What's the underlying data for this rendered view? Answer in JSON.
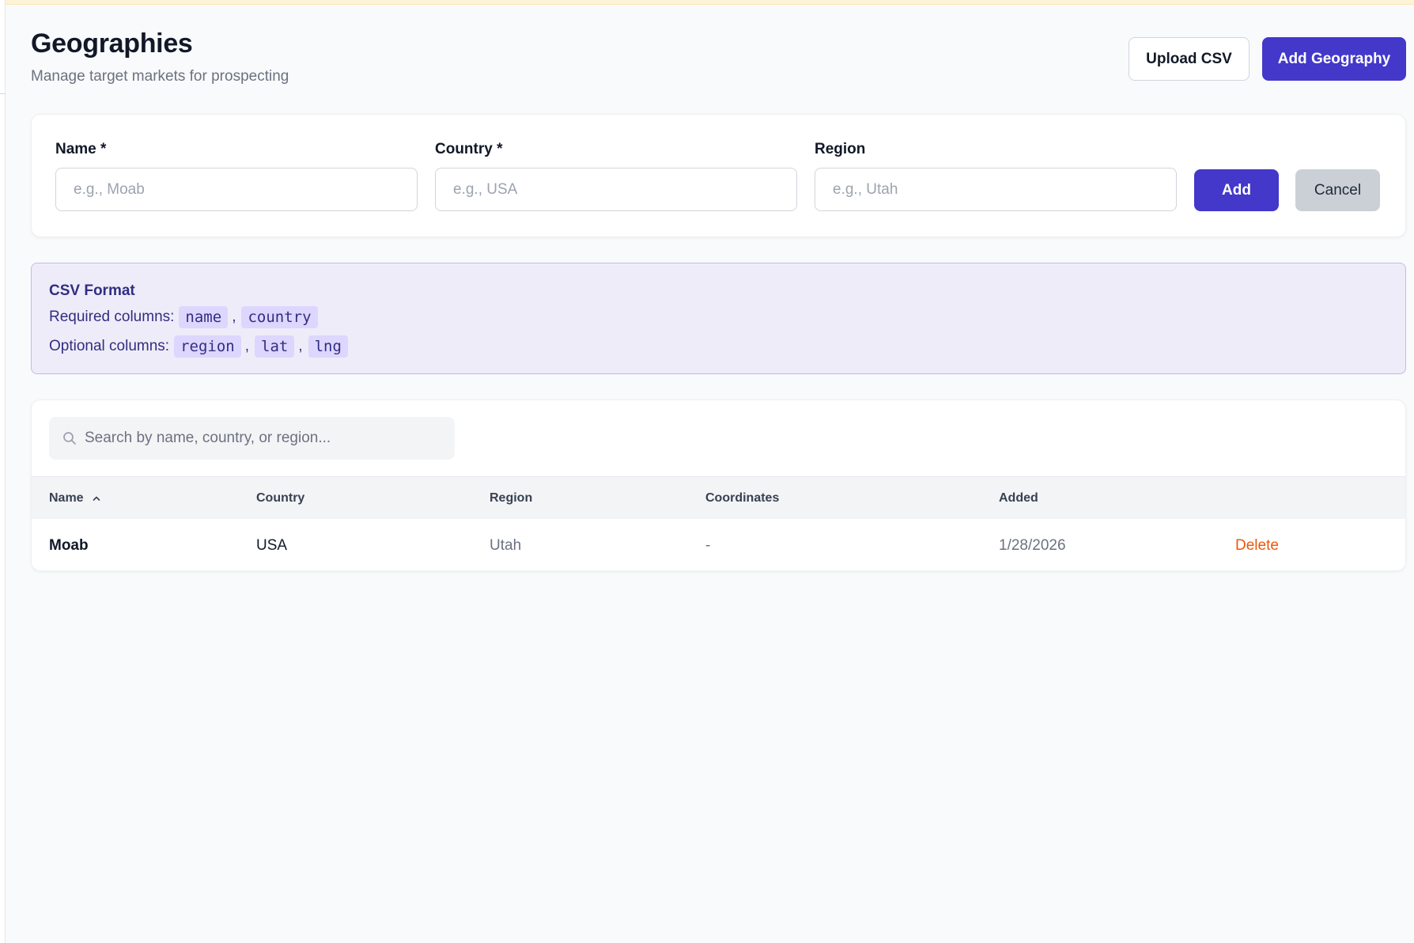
{
  "page": {
    "title": "Geographies",
    "subtitle": "Manage target markets for prospecting"
  },
  "header_actions": {
    "upload_csv_label": "Upload CSV",
    "add_geography_label": "Add Geography"
  },
  "form": {
    "name_label": "Name *",
    "name_placeholder": "e.g., Moab",
    "country_label": "Country *",
    "country_placeholder": "e.g., USA",
    "region_label": "Region",
    "region_placeholder": "e.g., Utah",
    "add_label": "Add",
    "cancel_label": "Cancel"
  },
  "csv_format": {
    "title": "CSV Format",
    "required_label": "Required columns:",
    "required_columns": [
      "name",
      "country"
    ],
    "optional_label": "Optional columns:",
    "optional_columns": [
      "region",
      "lat",
      "lng"
    ],
    "separator": ","
  },
  "search": {
    "placeholder": "Search by name, country, or region...",
    "value": ""
  },
  "table": {
    "columns": [
      "Name",
      "Country",
      "Region",
      "Coordinates",
      "Added"
    ],
    "sort": {
      "column": "Name",
      "direction": "ascending"
    },
    "rows": [
      {
        "name": "Moab",
        "country": "USA",
        "region": "Utah",
        "coordinates": "-",
        "added": "1/28/2026",
        "action": "Delete"
      }
    ]
  },
  "colors": {
    "primary": "#4338ca",
    "danger": "#ea580c",
    "info_bg": "#efecf9",
    "info_border": "#c4b8ef"
  }
}
